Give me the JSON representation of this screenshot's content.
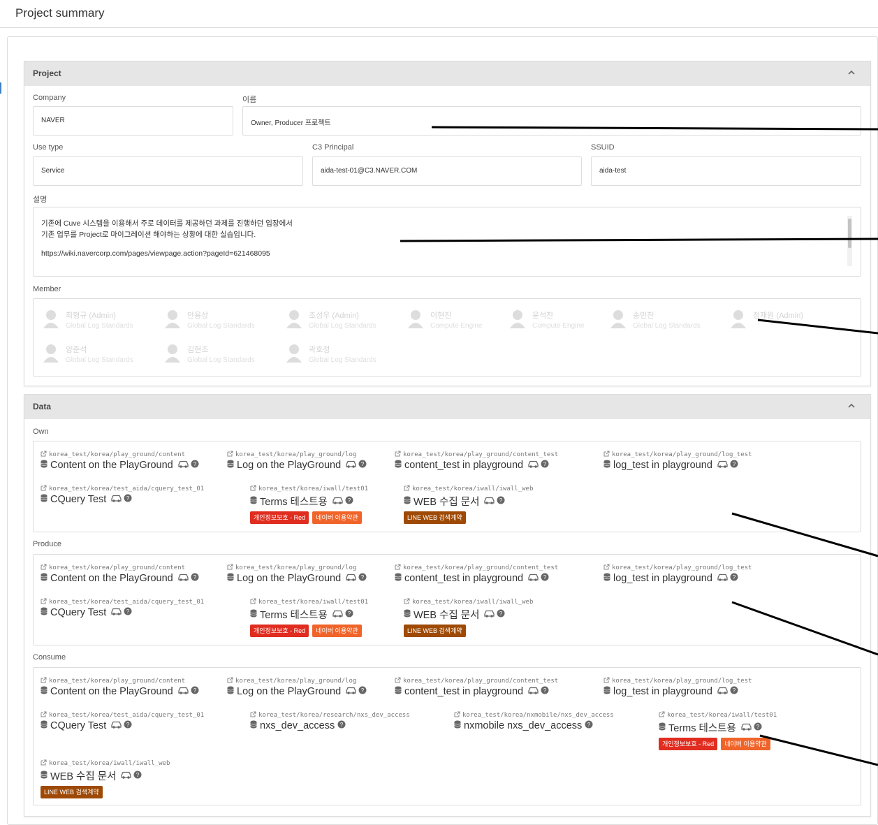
{
  "page": {
    "title": "Project summary"
  },
  "project": {
    "title": "Project",
    "company_label": "Company",
    "company_value": "NAVER",
    "name_label": "이름",
    "name_value": "Owner, Producer 프로젝트",
    "usetype_label": "Use type",
    "usetype_value": "Service",
    "principal_label": "C3 Principal",
    "principal_value": "aida-test-01@C3.NAVER.COM",
    "ssuid_label": "SSUID",
    "ssuid_value": "aida-test",
    "desc_label": "설명",
    "desc_lines": [
      "기존에 Cuve 시스템을 이용해서 주로 데이터를 제공하던 과제를 진행하던 입장에서",
      "기존 업무를 Project로 마이그레이션 해야하는 상황에 대한 실습입니다.",
      "https://wiki.navercorp.com/pages/viewpage.action?pageId=621468095"
    ],
    "member_label": "Member",
    "members": [
      {
        "name": "최형규 (Admin)",
        "team": "Global Log Standards"
      },
      {
        "name": "안용상",
        "team": "Global Log Standards"
      },
      {
        "name": "조성우 (Admin)",
        "team": "Global Log Standards"
      },
      {
        "name": "이현진",
        "team": "Compute Engine"
      },
      {
        "name": "윤석찬",
        "team": "Compute Engine"
      },
      {
        "name": "송민찬",
        "team": "Global Log Standards"
      },
      {
        "name": "정재원 (Admin)",
        "team": ""
      },
      {
        "name": "양준석",
        "team": "Global Log Standards"
      },
      {
        "name": "김현조",
        "team": "Global Log Standards"
      },
      {
        "name": "곽호정",
        "team": "Global Log Standards"
      }
    ]
  },
  "data": {
    "title": "Data",
    "sections": [
      {
        "label": "Own",
        "items": [
          {
            "path": "korea_test/korea/play_ground/content",
            "name": "Content on the PlayGround",
            "tags": []
          },
          {
            "path": "korea_test/korea/play_ground/log",
            "name": "Log on the PlayGround",
            "tags": []
          },
          {
            "path": "korea_test/korea/play_ground/content_test",
            "name": "content_test in playground",
            "tags": []
          },
          {
            "path": "korea_test/korea/play_ground/log_test",
            "name": "log_test in playground",
            "tags": []
          },
          {
            "path": "korea_test/korea/test_aida/cquery_test_01",
            "name": "CQuery Test",
            "tags": []
          },
          {
            "path": "korea_test/korea/iwall/test01",
            "name": "Terms 테스트용",
            "tags": [
              {
                "text": "개인정보보호 - Red",
                "color": "#e02d20"
              },
              {
                "text": "네이버 이용약관",
                "color": "#f0642a"
              }
            ]
          },
          {
            "path": "korea_test/korea/iwall/iwall_web",
            "name": "WEB 수집 문서",
            "tags": [
              {
                "text": "LINE WEB 검색계약",
                "color": "#9e4a06"
              }
            ]
          }
        ]
      },
      {
        "label": "Produce",
        "items": [
          {
            "path": "korea_test/korea/play_ground/content",
            "name": "Content on the PlayGround",
            "tags": []
          },
          {
            "path": "korea_test/korea/play_ground/log",
            "name": "Log on the PlayGround",
            "tags": []
          },
          {
            "path": "korea_test/korea/play_ground/content_test",
            "name": "content_test in playground",
            "tags": []
          },
          {
            "path": "korea_test/korea/play_ground/log_test",
            "name": "log_test in playground",
            "tags": []
          },
          {
            "path": "korea_test/korea/test_aida/cquery_test_01",
            "name": "CQuery Test",
            "tags": []
          },
          {
            "path": "korea_test/korea/iwall/test01",
            "name": "Terms 테스트용",
            "tags": [
              {
                "text": "개인정보보호 - Red",
                "color": "#e02d20"
              },
              {
                "text": "네이버 이용약관",
                "color": "#f0642a"
              }
            ]
          },
          {
            "path": "korea_test/korea/iwall/iwall_web",
            "name": "WEB 수집 문서",
            "tags": [
              {
                "text": "LINE WEB 검색계약",
                "color": "#9e4a06"
              }
            ]
          }
        ]
      },
      {
        "label": "Consume",
        "items": [
          {
            "path": "korea_test/korea/play_ground/content",
            "name": "Content on the PlayGround",
            "tags": []
          },
          {
            "path": "korea_test/korea/play_ground/log",
            "name": "Log on the PlayGround",
            "tags": []
          },
          {
            "path": "korea_test/korea/play_ground/content_test",
            "name": "content_test in playground",
            "tags": []
          },
          {
            "path": "korea_test/korea/play_ground/log_test",
            "name": "log_test in playground",
            "tags": []
          },
          {
            "path": "korea_test/korea/test_aida/cquery_test_01",
            "name": "CQuery Test",
            "tags": []
          },
          {
            "path": "korea_test/korea/research/nxs_dev_access",
            "name": "nxs_dev_access",
            "tags": []
          },
          {
            "path": "korea_test/korea/nxmobile/nxs_dev_access",
            "name": "nxmobile nxs_dev_access",
            "tags": []
          },
          {
            "path": "korea_test/korea/iwall/test01",
            "name": "Terms 테스트용",
            "tags": [
              {
                "text": "개인정보보호 - Red",
                "color": "#e02d20"
              },
              {
                "text": "네이버 이용약관",
                "color": "#f0642a"
              }
            ]
          },
          {
            "path": "korea_test/korea/iwall/iwall_web",
            "name": "WEB 수집 문서",
            "tags": [
              {
                "text": "LINE WEB 검색계약",
                "color": "#9e4a06"
              }
            ]
          }
        ]
      }
    ]
  },
  "colors": {
    "accent": "#3b82c4",
    "header_bg": "#e6e6e6",
    "tag_red": "#e02d20",
    "tag_orange": "#f0642a",
    "tag_brown": "#9e4a06"
  }
}
